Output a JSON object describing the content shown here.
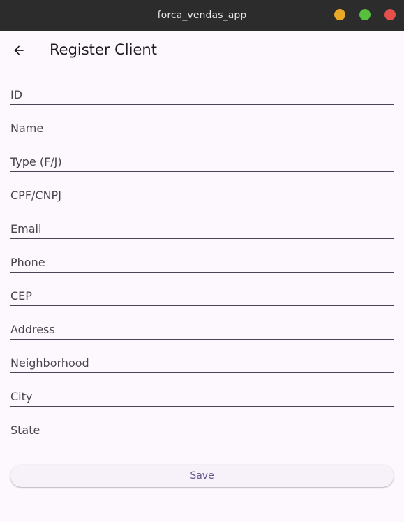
{
  "window": {
    "title": "forca_vendas_app"
  },
  "appbar": {
    "title": "Register Client"
  },
  "fields": [
    {
      "label": "ID",
      "value": ""
    },
    {
      "label": "Name",
      "value": ""
    },
    {
      "label": "Type (F/J)",
      "value": ""
    },
    {
      "label": "CPF/CNPJ",
      "value": ""
    },
    {
      "label": "Email",
      "value": ""
    },
    {
      "label": "Phone",
      "value": ""
    },
    {
      "label": "CEP",
      "value": ""
    },
    {
      "label": "Address",
      "value": ""
    },
    {
      "label": "Neighborhood",
      "value": ""
    },
    {
      "label": "City",
      "value": ""
    },
    {
      "label": "State",
      "value": ""
    }
  ],
  "save": {
    "label": "Save"
  },
  "icons": {
    "back": "arrow-back-icon"
  },
  "colors": {
    "window_minimize": "#e8a928",
    "window_maximize": "#56bf3c",
    "window_close": "#e5504a",
    "primary": "#65558f",
    "background": "#fdf7fe"
  }
}
